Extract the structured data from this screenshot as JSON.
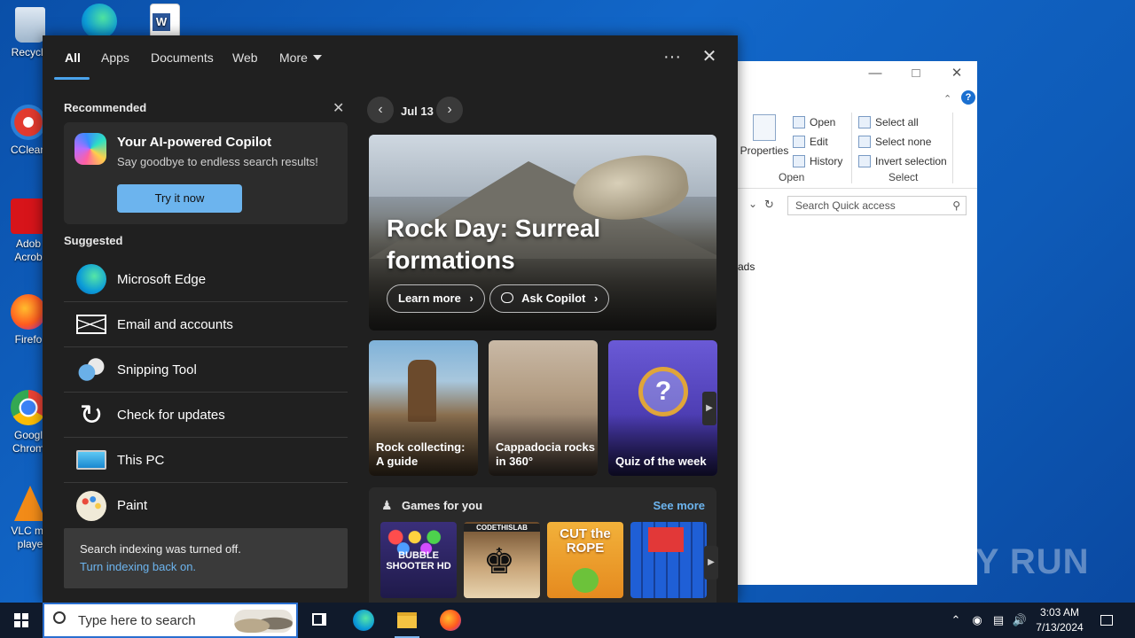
{
  "desktop": {
    "icons": [
      {
        "label": "Recycle",
        "name": "recycle-bin"
      },
      {
        "label": "CClean",
        "name": "ccleaner"
      },
      {
        "label": "Adob\nAcrob",
        "name": "adobe-acrobat"
      },
      {
        "label": "Firefo",
        "name": "firefox"
      },
      {
        "label": "Googl\nChrom",
        "name": "google-chrome"
      },
      {
        "label": "VLC me\nplaye",
        "name": "vlc-player"
      }
    ]
  },
  "explorer": {
    "ribbon": {
      "properties": "Properties",
      "open": "Open",
      "edit": "Edit",
      "history": "History",
      "open_group": "Open",
      "select_all": "Select all",
      "select_none": "Select none",
      "invert_selection": "Invert selection",
      "select_group": "Select"
    },
    "search_placeholder": "Search Quick access",
    "content_fragment": "ads"
  },
  "search_panel": {
    "tabs": [
      "All",
      "Apps",
      "Documents",
      "Web",
      "More"
    ],
    "recommended": {
      "heading": "Recommended",
      "title": "Your AI-powered Copilot",
      "subtitle": "Say goodbye to endless search results!",
      "button": "Try it now"
    },
    "suggested": {
      "heading": "Suggested",
      "items": [
        {
          "label": "Microsoft Edge",
          "icon": "edge-icon"
        },
        {
          "label": "Email and accounts",
          "icon": "mail-icon"
        },
        {
          "label": "Snipping Tool",
          "icon": "scissors-icon"
        },
        {
          "label": "Check for updates",
          "icon": "refresh-icon"
        },
        {
          "label": "This PC",
          "icon": "computer-icon"
        },
        {
          "label": "Paint",
          "icon": "palette-icon"
        }
      ]
    },
    "indexing": {
      "text": "Search indexing was turned off.",
      "link": "Turn indexing back on."
    },
    "highlights": {
      "date": "Jul 13",
      "hero_title": "Rock Day: Surreal formations",
      "learn_more": "Learn more",
      "ask_copilot": "Ask Copilot",
      "tiles": [
        {
          "label": "Rock collecting: A guide"
        },
        {
          "label": "Cappadocia rocks in 360°"
        },
        {
          "label": "Quiz of the week"
        }
      ]
    },
    "games": {
      "title": "Games for you",
      "see_more": "See more",
      "items": [
        "BUBBLE SHOOTER HD",
        "CODETHISLAB",
        "CUT the ROPE",
        ""
      ]
    }
  },
  "taskbar": {
    "search_placeholder": "Type here to search",
    "time": "3:03 AM",
    "date": "7/13/2024"
  },
  "watermark": "ANY RUN"
}
